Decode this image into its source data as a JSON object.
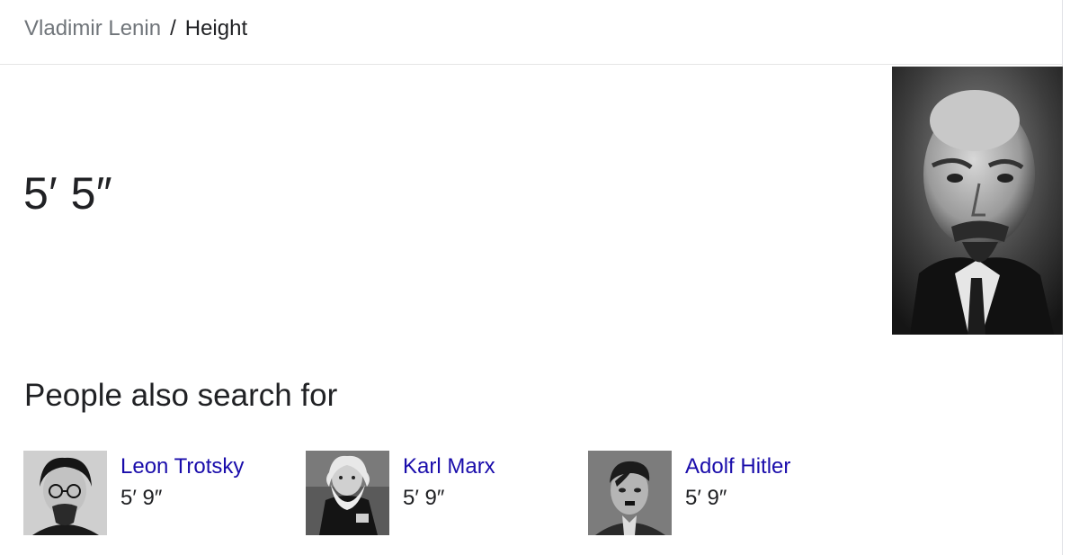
{
  "breadcrumb": {
    "parent": "Vladimir Lenin",
    "separator": "/",
    "current": "Height"
  },
  "answer": {
    "value": "5′ 5″"
  },
  "people_also_search_for": {
    "heading": "People also search for",
    "items": [
      {
        "name": "Leon Trotsky",
        "height": "5′ 9″"
      },
      {
        "name": "Karl Marx",
        "height": "5′ 9″"
      },
      {
        "name": "Adolf Hitler",
        "height": "5′ 9″"
      }
    ]
  },
  "colors": {
    "link": "#1a0dab",
    "text": "#202124",
    "muted": "#70757a",
    "divider": "#e5e5e5"
  }
}
